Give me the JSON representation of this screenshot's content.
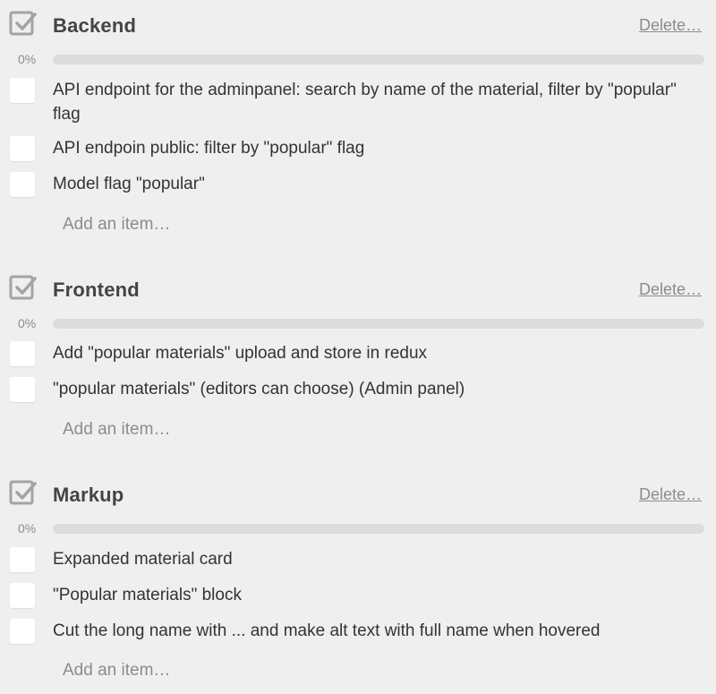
{
  "checklists": [
    {
      "title": "Backend",
      "delete_label": "Delete…",
      "progress_label": "0%",
      "progress": 0,
      "items": [
        "API endpoint for the adminpanel: search by name of the material, filter by \"popular\" flag",
        "API endpoin public: filter by \"popular\" flag",
        "Model flag \"popular\""
      ],
      "add_label": "Add an item…"
    },
    {
      "title": "Frontend",
      "delete_label": "Delete…",
      "progress_label": "0%",
      "progress": 0,
      "items": [
        "Add \"popular materials\" upload and store in redux",
        "\"popular materials\" (editors can choose) (Admin panel)"
      ],
      "add_label": "Add an item…"
    },
    {
      "title": "Markup",
      "delete_label": "Delete…",
      "progress_label": "0%",
      "progress": 0,
      "items": [
        "Expanded material card",
        "\"Popular materials\" block",
        "Cut the long name with ... and make alt text with full name when hovered"
      ],
      "add_label": "Add an item…"
    }
  ],
  "icons": {
    "checklist_icon": "checkbox-checked-icon"
  },
  "colors": {
    "background": "#efefef",
    "bar_track": "#dcdcdc",
    "muted_text": "#8c8c8c"
  }
}
